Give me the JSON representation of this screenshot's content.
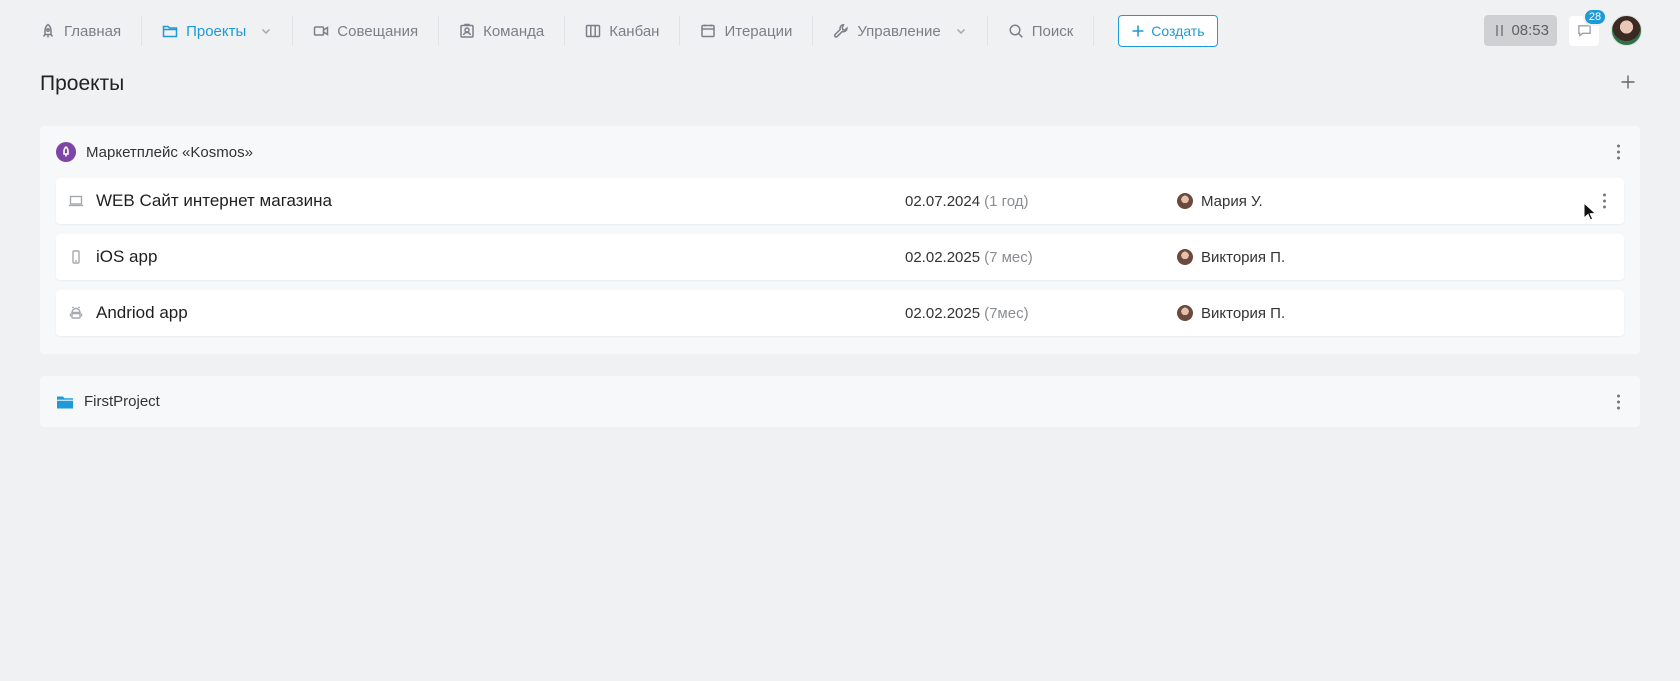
{
  "nav": {
    "home": "Главная",
    "projects": "Проекты",
    "meetings": "Совещания",
    "team": "Команда",
    "kanban": "Канбан",
    "iterations": "Итерации",
    "management": "Управление",
    "search": "Поиск",
    "create": "Создать"
  },
  "toolbar": {
    "timer": "08:53",
    "notifications_count": "28"
  },
  "page": {
    "title": "Проекты"
  },
  "groups": [
    {
      "name": "Маркетплейс «Kosmos»",
      "projects": [
        {
          "icon": "laptop-icon",
          "name": "WEB Сайт интернет магазина",
          "date": "02.07.2024",
          "ago": "(1 год)",
          "user": "Мария У."
        },
        {
          "icon": "phone-icon",
          "name": "iOS app",
          "date": "02.02.2025",
          "ago": "(7 мес)",
          "user": "Виктория П."
        },
        {
          "icon": "android-icon",
          "name": "Andriod app",
          "date": "02.02.2025",
          "ago": "(7мес)",
          "user": "Виктория П."
        }
      ]
    },
    {
      "name": "FirstProject",
      "projects": []
    }
  ],
  "colors": {
    "accent": "#1e9ad6",
    "kosmos": "#7d45a5",
    "background": "#f0f1f3"
  }
}
